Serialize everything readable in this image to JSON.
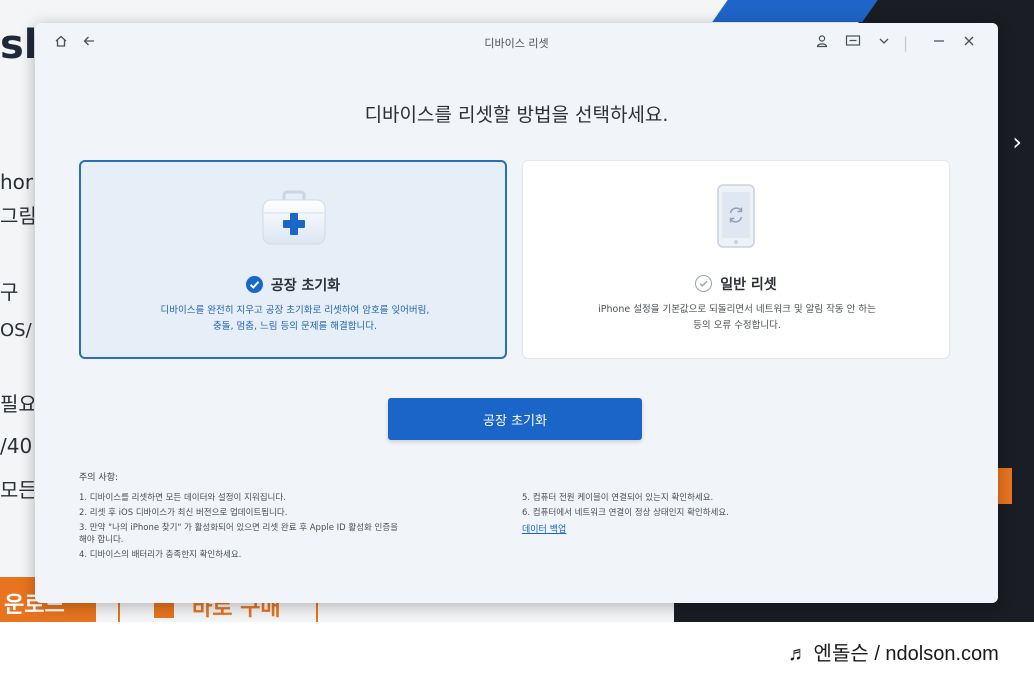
{
  "background": {
    "logo_fragment": "sh",
    "side_texts": [
      "hor",
      "그림",
      "구",
      "OS/",
      "필요",
      "/40",
      "모든"
    ],
    "orange_button_text": "운로드",
    "buy_button_text": "바로 구매",
    "right_mark": "›"
  },
  "dialog": {
    "title": "디바이스 리셋",
    "icons": {
      "home": "home-icon",
      "back": "back-arrow-icon",
      "user": "user-icon",
      "feedback": "feedback-icon",
      "menu": "chevron-down-icon",
      "minimize": "minimize-icon",
      "close": "close-icon"
    },
    "heading": "디바이스를 리셋할 방법을 선택하세요.",
    "options": [
      {
        "title": "공장 초기화",
        "desc_line1": "디바이스를 완전히 지우고 공장 초기화로 리셋하여 암호를 잊어버림,",
        "desc_line2": "충돌, 멈춤, 느림 등의 문제를 해결합니다.",
        "selected": true
      },
      {
        "title": "일반 리셋",
        "desc_line1": "iPhone 설정을 기본값으로 되돌리면서 네트워크 및 알림 작동 안 하는",
        "desc_line2": "등의 오류 수정합니다.",
        "selected": false
      }
    ],
    "primary_button": "공장 초기화",
    "notes_title": "주의 사항:",
    "notes_left": [
      "1. 디바이스를 리셋하면 모든 데이터와 설정이 지워집니다.",
      "2. 리셋 후 iOS 디바이스가 최신 버전으로 업데이트됩니다.",
      "3. 만약 \"나의 iPhone 찾기\" 가 활성화되어 있으면 리셋 완료 후 Apple ID 활성화 인증을",
      "해야 합니다.",
      "4. 디바이스의 배터리가 충족한지 확인하세요."
    ],
    "notes_right": [
      "5. 컴퓨터 전원 케이블이 연결되어 있는지 확인하세요.",
      "6. 컴퓨터에서 네트워크 연결이 정상 상태인지 확인하세요."
    ],
    "notes_link": "데이터 백업"
  },
  "watermark": "♬ 엔돌슨 / ndolson.com",
  "colors": {
    "accent": "#1b64c8",
    "selected_border": "#2a6fb8",
    "selected_bg": "#e6eef7",
    "dialog_bg": "#f1f4f8"
  }
}
